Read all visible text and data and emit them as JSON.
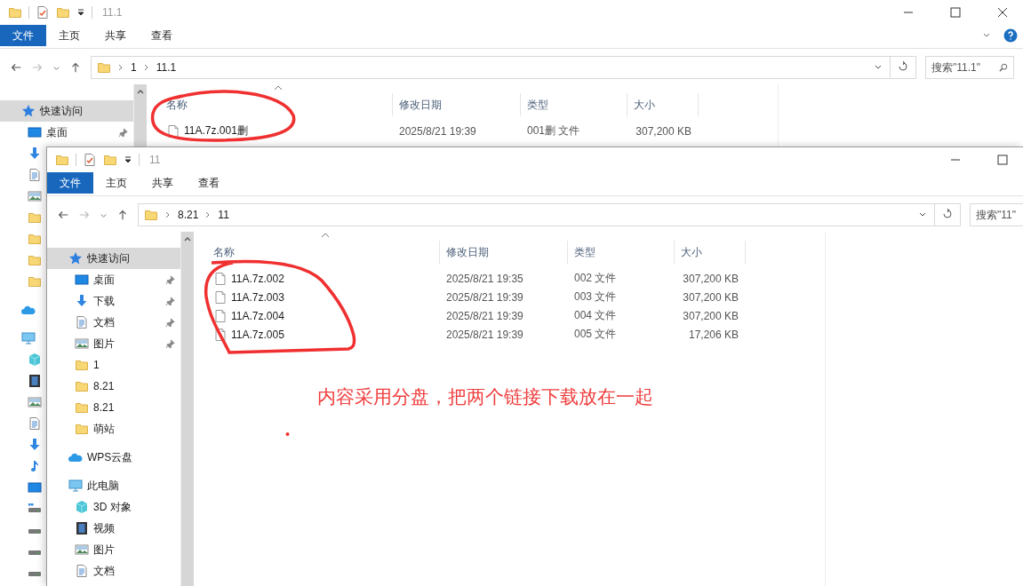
{
  "back_window": {
    "title": "11.1",
    "ribbon_tabs": [
      {
        "label": "文件",
        "selected": true
      },
      {
        "label": "主页",
        "selected": false
      },
      {
        "label": "共享",
        "selected": false
      },
      {
        "label": "查看",
        "selected": false
      }
    ],
    "breadcrumb": [
      "1",
      "11.1"
    ],
    "search": {
      "placeholder": "搜索\"11.1\""
    },
    "sidebar": [
      {
        "label": "快速访问",
        "kind": "star",
        "selected": true,
        "children": [
          {
            "label": "桌面",
            "kind": "desktop",
            "pinned": true,
            "selected": false
          },
          {
            "kind": "download"
          },
          {
            "kind": "doc"
          },
          {
            "kind": "picture"
          },
          {
            "kind": "folder"
          },
          {
            "kind": "folder"
          },
          {
            "kind": "folder"
          },
          {
            "kind": "folder"
          }
        ]
      },
      {
        "kind": "cloud"
      },
      {
        "kind": "pc",
        "children": [
          {
            "kind": "cube"
          },
          {
            "kind": "video"
          },
          {
            "kind": "picture"
          },
          {
            "kind": "doc"
          },
          {
            "kind": "download"
          },
          {
            "kind": "music"
          },
          {
            "kind": "desktop"
          },
          {
            "kind": "drivewin"
          },
          {
            "kind": "drive"
          },
          {
            "kind": "drive"
          },
          {
            "kind": "drive"
          }
        ]
      }
    ],
    "columns": [
      "名称",
      "修改日期",
      "类型",
      "大小"
    ],
    "files": [
      {
        "name": "11A.7z.001删",
        "modified": "2025/8/21 19:39",
        "type": "001删 文件",
        "size": "307,200 KB"
      }
    ]
  },
  "front_window": {
    "title": "11",
    "ribbon_tabs": [
      {
        "label": "文件",
        "selected": true
      },
      {
        "label": "主页",
        "selected": false
      },
      {
        "label": "共享",
        "selected": false
      },
      {
        "label": "查看",
        "selected": false
      }
    ],
    "breadcrumb": [
      "8.21",
      "11"
    ],
    "search": {
      "placeholder": "搜索\"11\""
    },
    "sidebar": [
      {
        "label": "快速访问",
        "kind": "star",
        "selected": true,
        "children": [
          {
            "label": "桌面",
            "kind": "desktop",
            "pinned": true,
            "selected": false
          },
          {
            "label": "下载",
            "kind": "download",
            "pinned": true,
            "selected": false
          },
          {
            "label": "文档",
            "kind": "doc",
            "pinned": true,
            "selected": false
          },
          {
            "label": "图片",
            "kind": "picture",
            "pinned": true,
            "selected": false
          },
          {
            "label": "1",
            "kind": "folder",
            "pinned": false,
            "selected": false
          },
          {
            "label": "8.21",
            "kind": "folder",
            "pinned": false,
            "selected": false
          },
          {
            "label": "8.21",
            "kind": "folder",
            "pinned": false,
            "selected": false
          },
          {
            "label": "萌站",
            "kind": "folder",
            "pinned": false,
            "selected": false
          }
        ]
      },
      {
        "label": "WPS云盘",
        "kind": "cloud",
        "selected": false
      },
      {
        "label": "此电脑",
        "kind": "pc",
        "selected": false,
        "children": [
          {
            "label": "3D 对象",
            "kind": "cube",
            "selected": false
          },
          {
            "label": "视频",
            "kind": "video",
            "selected": false
          },
          {
            "label": "图片",
            "kind": "picture",
            "selected": false
          },
          {
            "label": "文档",
            "kind": "doc",
            "selected": false
          }
        ]
      }
    ],
    "columns": [
      "名称",
      "修改日期",
      "类型",
      "大小"
    ],
    "files": [
      {
        "name": "11A.7z.002",
        "modified": "2025/8/21 19:35",
        "type": "002 文件",
        "size": "307,200 KB"
      },
      {
        "name": "11A.7z.003",
        "modified": "2025/8/21 19:39",
        "type": "003 文件",
        "size": "307,200 KB"
      },
      {
        "name": "11A.7z.004",
        "modified": "2025/8/21 19:39",
        "type": "004 文件",
        "size": "307,200 KB"
      },
      {
        "name": "11A.7z.005",
        "modified": "2025/8/21 19:39",
        "type": "005 文件",
        "size": "17,206 KB"
      }
    ]
  },
  "annotation": {
    "note": "内容采用分盘，把两个链接下载放在一起"
  }
}
